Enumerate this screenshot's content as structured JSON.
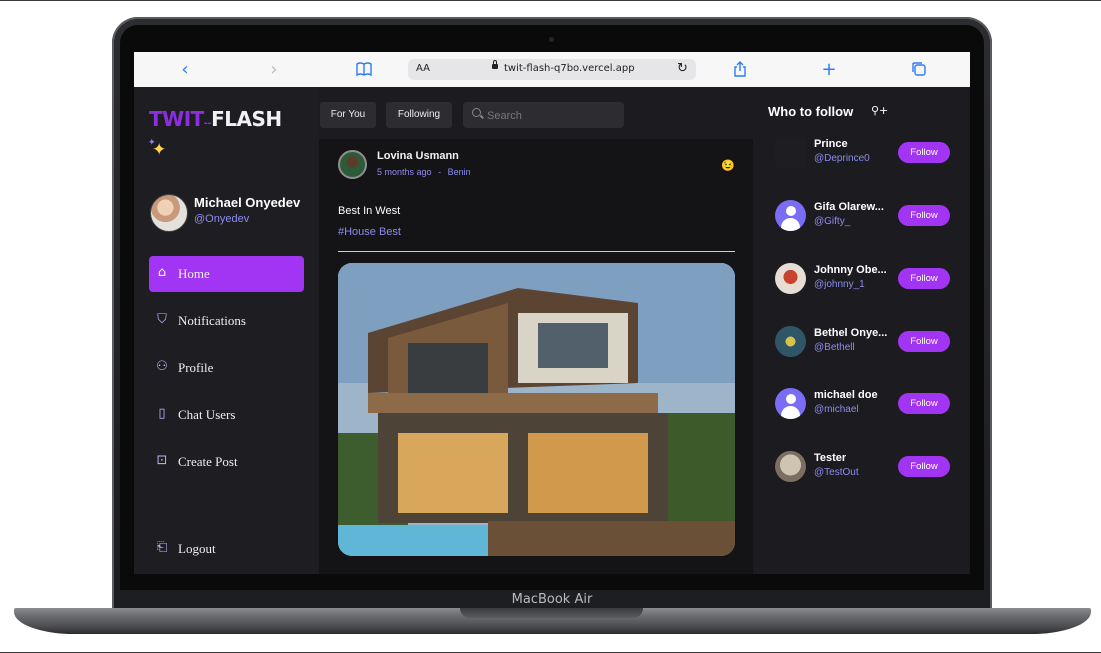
{
  "device": {
    "label": "MacBook Air"
  },
  "browser": {
    "aa_label": "AA",
    "url": "twit-flash-q7bo.vercel.app",
    "icons": [
      "back-icon",
      "forward-icon",
      "bookmarks-icon",
      "reload-icon",
      "share-icon",
      "new-tab-icon",
      "tabs-icon"
    ]
  },
  "app": {
    "logo_part1": "TWIT",
    "logo_part2": "FLASH",
    "accent_color": "#a234f3",
    "handle_color": "#8c8cf0"
  },
  "user": {
    "name": "Michael Onyedev",
    "handle": "@Onyedev"
  },
  "nav": [
    {
      "label": "Home",
      "icon": "home-icon",
      "active": true
    },
    {
      "label": "Notifications",
      "icon": "bell-icon",
      "active": false
    },
    {
      "label": "Profile",
      "icon": "user-icon",
      "active": false
    },
    {
      "label": "Chat Users",
      "icon": "chat-icon",
      "active": false
    },
    {
      "label": "Create Post",
      "icon": "create-post-icon",
      "active": false
    }
  ],
  "logout_label": "Logout",
  "feed": {
    "tabs": [
      "For You",
      "Following"
    ],
    "search_placeholder": "Search",
    "post": {
      "author": "Lovina Usmann",
      "time": "5 months ago",
      "separator": "-",
      "location": "Benin",
      "emoji": "😉",
      "text": "Best In West",
      "tag": "#House Best"
    }
  },
  "who_to_follow": {
    "title": "Who to follow",
    "follow_label": "Follow",
    "users": [
      {
        "name": "Prince",
        "handle": "@Deprince0",
        "avatar": "image-avatar"
      },
      {
        "name": "Gifa Olarew...",
        "handle": "@Gifty_",
        "avatar": "default-avatar"
      },
      {
        "name": "Johnny Obe...",
        "handle": "@johnny_1",
        "avatar": "image-avatar"
      },
      {
        "name": "Bethel Onye...",
        "handle": "@Bethell",
        "avatar": "image-avatar"
      },
      {
        "name": "michael doe",
        "handle": "@michael",
        "avatar": "default-avatar"
      },
      {
        "name": "Tester",
        "handle": "@TestOut",
        "avatar": "image-avatar"
      }
    ]
  }
}
